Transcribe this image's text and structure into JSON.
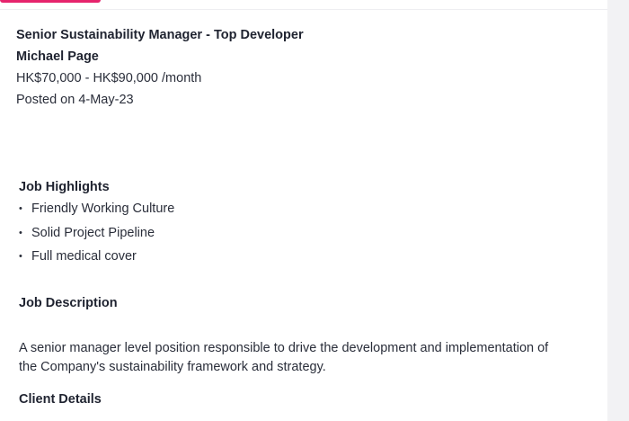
{
  "job": {
    "title": "Senior Sustainability Manager - Top Developer",
    "company": "Michael Page",
    "salary": "HK$70,000 - HK$90,000 /month",
    "posted": "Posted on 4-May-23"
  },
  "highlights": {
    "heading": "Job Highlights",
    "items": [
      "Friendly Working Culture",
      "Solid Project Pipeline",
      "Full medical cover"
    ]
  },
  "description": {
    "heading": "Job Description",
    "body": "A senior manager level position responsible to drive the development and implementation of the Company's sustainability framework and strategy."
  },
  "client": {
    "heading": "Client Details"
  },
  "colors": {
    "accent": "#e6246d",
    "text": "#1f2330",
    "gutter": "#f2f2f4"
  }
}
